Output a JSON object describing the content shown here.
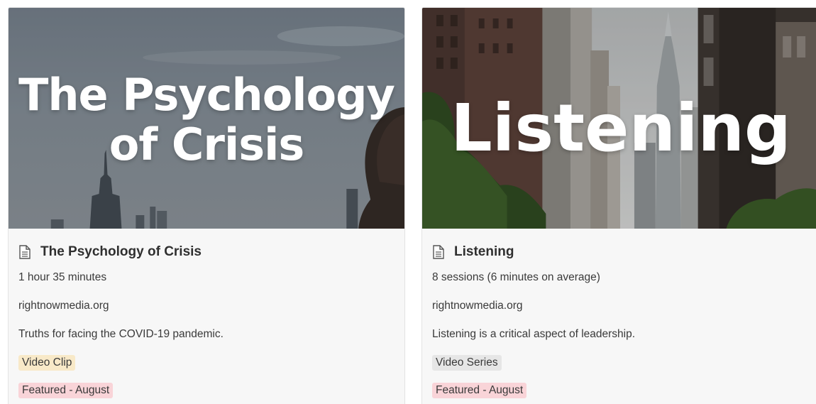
{
  "cards": [
    {
      "cover_text": "The Psychology\nof Crisis",
      "title": "The Psychology of Crisis",
      "duration": "1 hour 35 minutes",
      "source": "rightnowmedia.org",
      "description": "Truths for facing the COVID-19 pandemic.",
      "type_tag": "Video Clip",
      "type_tag_color": "#f8e9c8",
      "feature_tag": "Featured - August",
      "feature_tag_color": "#f9d4d8",
      "icon": "document-icon"
    },
    {
      "cover_text": "Listening",
      "title": "Listening",
      "duration": "8 sessions (6 minutes on average)",
      "source": "rightnowmedia.org",
      "description": "Listening is a critical aspect of leadership.",
      "type_tag": "Video Series",
      "type_tag_color": "#e6e6e6",
      "feature_tag": "Featured - August",
      "feature_tag_color": "#f9d4d8",
      "icon": "document-icon"
    }
  ]
}
